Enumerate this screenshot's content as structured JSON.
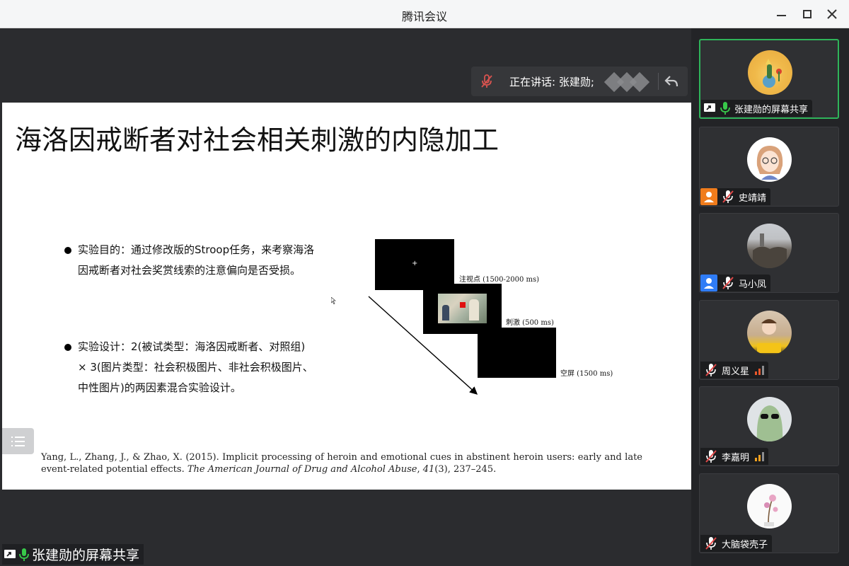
{
  "window": {
    "title": "腾讯会议"
  },
  "speaker_bar": {
    "text": "正在讲话: 张建勋;"
  },
  "slide": {
    "title": "海洛因戒断者对社会相关刺激的内隐加工",
    "bullets": [
      "实验目的：通过修改版的Stroop任务，来考察海洛因戒断者对社会奖赏线索的注意偏向是否受损。",
      "实验设计：2(被试类型：海洛因戒断者、对照组) × 3(图片类型：社会积极图片、非社会积极图片、中性图片)的两因素混合实验设计。"
    ],
    "trial_captions": {
      "fixation": "注视点 (1500-2000 ms)",
      "stimulus": "刺激 (500 ms)",
      "blank": "空屏 (1500 ms)"
    },
    "fixation_glyph": "+",
    "reference": {
      "authors_title": "Yang, L., Zhang, J., & Zhao, X. (2015). Implicit processing of heroin and emotional cues in abstinent heroin users: early and late event-related potential effects.",
      "journal": "The American Journal of Drug and Alcohol Abuse",
      "volume": "41",
      "issue_pages": "(3), 237–245."
    }
  },
  "share_label": {
    "text": "张建勋的屏幕共享"
  },
  "participants": [
    {
      "name": "张建勋的屏幕共享",
      "avatar": "little-prince-avatar",
      "mic": "on",
      "role": "sharing",
      "active": true
    },
    {
      "name": "史靖靖",
      "avatar": "girl-avatar",
      "mic": "muted",
      "role": "host",
      "role_color": "#f07c1c"
    },
    {
      "name": "马小凤",
      "avatar": "town-photo-avatar",
      "mic": "muted",
      "role": "co-host",
      "role_color": "#2f7cf6"
    },
    {
      "name": "周义星",
      "avatar": "photo-avatar",
      "mic": "muted",
      "signal": "weak"
    },
    {
      "name": "李嘉明",
      "avatar": "ghost-avatar",
      "mic": "muted",
      "signal": "weak"
    },
    {
      "name": "大脑袋壳子",
      "avatar": "flower-avatar",
      "mic": "muted"
    }
  ],
  "colors": {
    "active_border": "#2fb45a",
    "signal": "#e8562a",
    "host_badge": "#f07c1c",
    "cohost_badge": "#2f7cf6",
    "mic_on": "#38c94a"
  }
}
